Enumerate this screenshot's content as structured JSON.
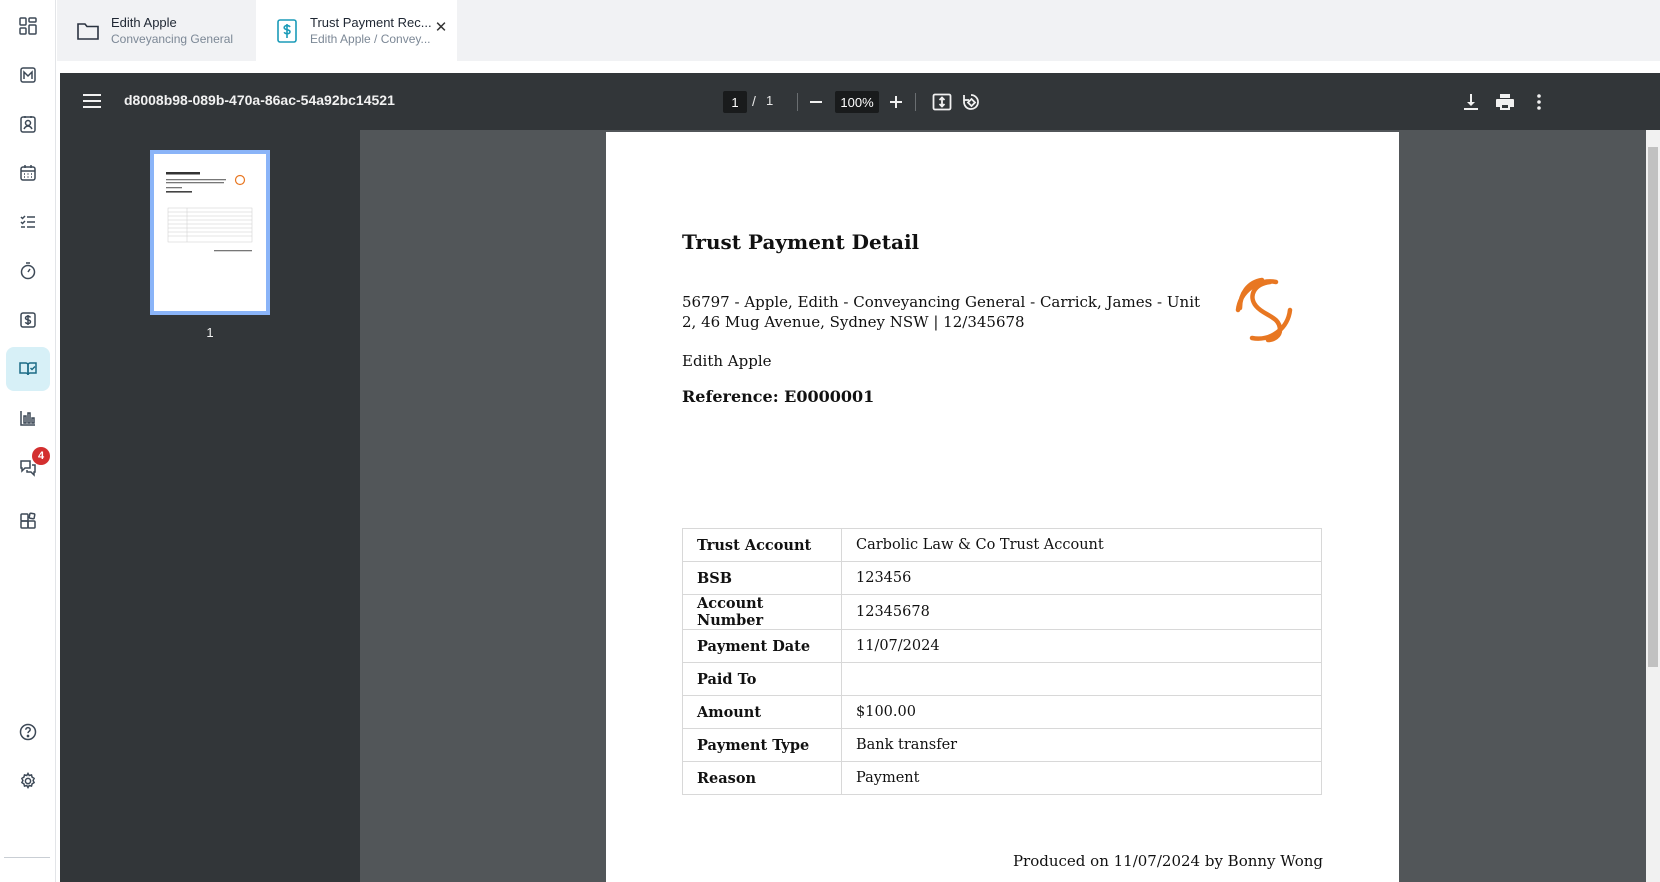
{
  "nav_rail": {
    "items": [
      {
        "name": "dashboard-icon"
      },
      {
        "name": "matters-icon"
      },
      {
        "name": "contacts-icon"
      },
      {
        "name": "calendar-icon"
      },
      {
        "name": "tasks-icon"
      },
      {
        "name": "timer-icon"
      },
      {
        "name": "billing-icon"
      },
      {
        "name": "trust-icon",
        "active": true
      },
      {
        "name": "reports-icon"
      },
      {
        "name": "messages-icon",
        "badge": "4"
      },
      {
        "name": "apps-icon"
      },
      {
        "name": "help-icon"
      },
      {
        "name": "settings-icon"
      }
    ]
  },
  "tabs": [
    {
      "title": "Edith Apple",
      "subtitle": "Conveyancing General",
      "icon": "folder-icon"
    },
    {
      "title": "Trust Payment Rec...",
      "subtitle": "Edith Apple / Convey...",
      "icon": "dollar-document-icon",
      "close": "✕"
    }
  ],
  "viewer": {
    "file_name": "d8008b98-089b-470a-86ac-54a92bc14521",
    "current_page": "1",
    "page_separator": "/",
    "total_pages": "1",
    "zoom": "100%",
    "thumbnail_label": "1"
  },
  "document": {
    "title": "Trust Payment Detail",
    "matter_line": "56797 - Apple, Edith - Conveyancing General - Carrick, James - Unit 2, 46 Mug Avenue, Sydney NSW | 12/345678",
    "client_name": "Edith Apple",
    "reference": "Reference: E0000001",
    "rows": [
      {
        "label": "Trust Account",
        "value": "Carbolic Law & Co Trust Account"
      },
      {
        "label": "BSB",
        "value": "123456"
      },
      {
        "label": "Account Number",
        "value": "12345678"
      },
      {
        "label": "Payment Date",
        "value": "11/07/2024"
      },
      {
        "label": "Paid To",
        "value": ""
      },
      {
        "label": "Amount",
        "value": "$100.00"
      },
      {
        "label": "Payment Type",
        "value": "Bank transfer"
      },
      {
        "label": "Reason",
        "value": "Payment"
      }
    ],
    "footer": "Produced on 11/07/2024 by Bonny Wong",
    "logo_color": "#e87722"
  },
  "colors": {
    "accent": "#1b9bb8",
    "active_nav_bg": "#d7f0f7",
    "viewer_toolbar": "#323639",
    "viewer_bg": "#525659",
    "badge": "#d32f2f"
  }
}
